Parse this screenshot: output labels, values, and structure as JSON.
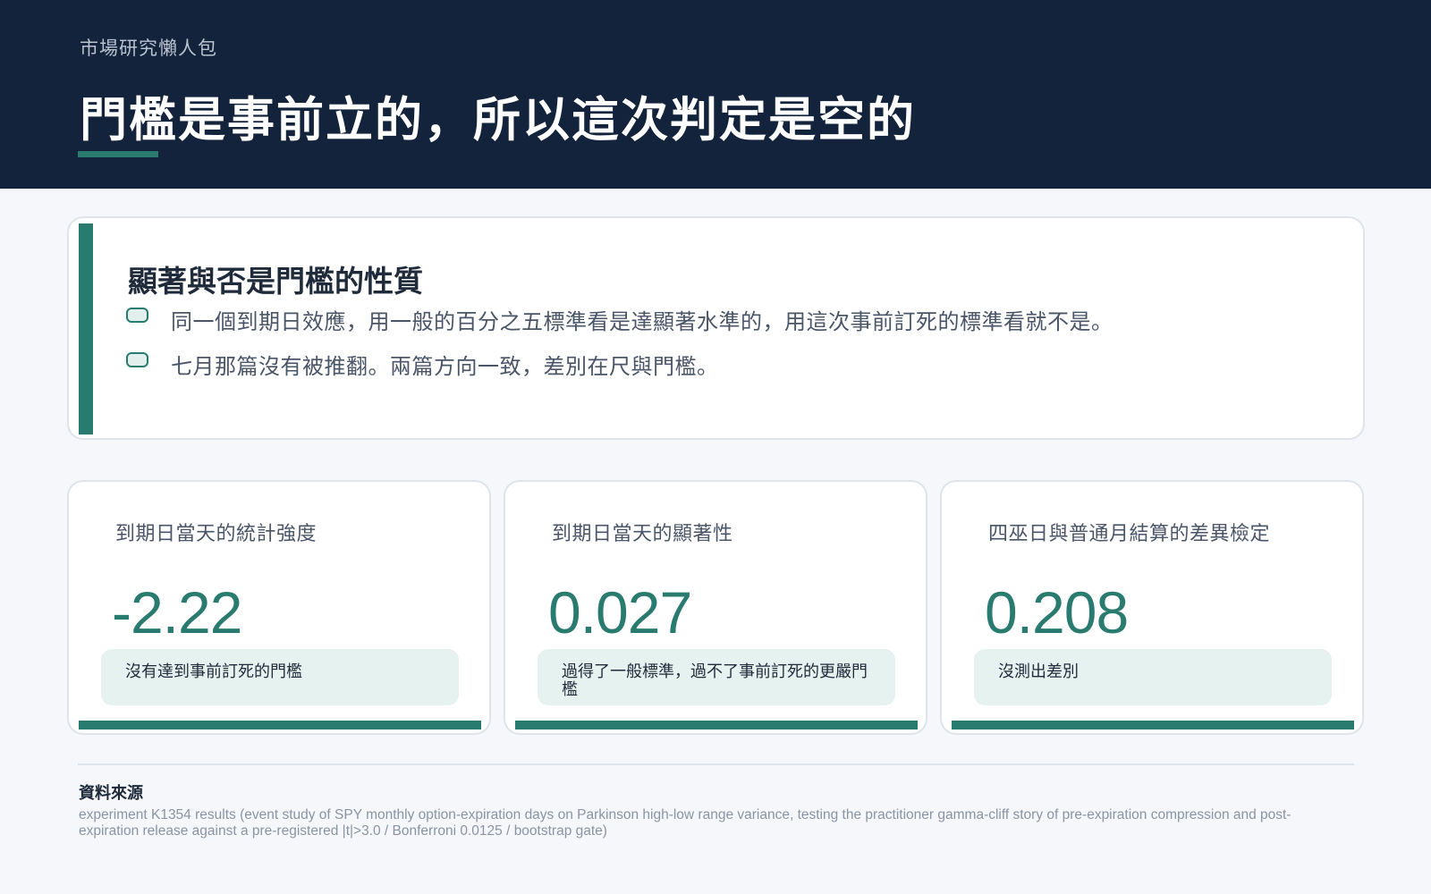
{
  "header": {
    "kicker": "市場研究懶人包",
    "title": "門檻是事前立的，所以這次判定是空的"
  },
  "summary": {
    "heading": "顯著與否是門檻的性質",
    "bullets": [
      "同一個到期日效應，用一般的百分之五標準看是達顯著水準的，用這次事前訂死的標準看就不是。",
      "七月那篇沒有被推翻。兩篇方向一致，差別在尺與門檻。"
    ]
  },
  "metrics": [
    {
      "label": "到期日當天的統計強度",
      "value": "-2.22",
      "note": "沒有達到事前訂死的門檻"
    },
    {
      "label": "到期日當天的顯著性",
      "value": "0.027",
      "note": "過得了一般標準，過不了事前訂死的更嚴門檻"
    },
    {
      "label": "四巫日與普通月結算的差異檢定",
      "value": "0.208",
      "note": "沒測出差別"
    }
  ],
  "source": {
    "heading": "資料來源",
    "text": "experiment K1354 results (event study of SPY monthly option-expiration days on Parkinson high-low range variance, testing the practitioner gamma-cliff story of pre-expiration compression and post-expiration release against a pre-registered |t|>3.0 / Bonferroni 0.0125 / bootstrap gate)"
  },
  "colors": {
    "header_bg": "#14233c",
    "accent": "#2a7b6f",
    "note_bg": "#e6f2ef",
    "page_bg": "#f5f7fa"
  }
}
